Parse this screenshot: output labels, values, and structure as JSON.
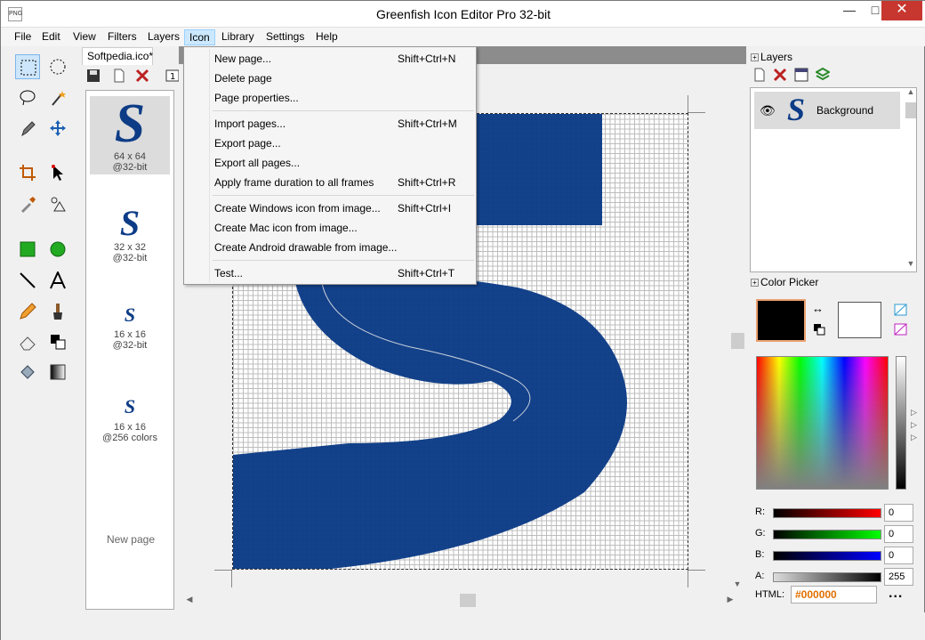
{
  "window": {
    "title": "Greenfish Icon Editor Pro 32-bit",
    "app_icon_text": "PNG",
    "minimize": "—",
    "maximize": "□",
    "close": "✕"
  },
  "menubar": {
    "items": [
      "File",
      "Edit",
      "View",
      "Filters",
      "Layers",
      "Icon",
      "Library",
      "Settings",
      "Help"
    ],
    "active": "Icon"
  },
  "document": {
    "tab_label": "Softpedia.ico*"
  },
  "pages": {
    "items": [
      {
        "size": "64 x 64",
        "depth": "@32-bit"
      },
      {
        "size": "32 x 32",
        "depth": "@32-bit"
      },
      {
        "size": "16 x 16",
        "depth": "@32-bit"
      },
      {
        "size": "16 x 16",
        "depth": "@256 colors"
      }
    ],
    "new_page": "New page",
    "thumb_glyph": "S"
  },
  "icon_menu": {
    "items": [
      {
        "label": "New page...",
        "shortcut": "Shift+Ctrl+N"
      },
      {
        "label": "Delete page",
        "shortcut": ""
      },
      {
        "label": "Page properties...",
        "shortcut": ""
      },
      {
        "label": "Import pages...",
        "shortcut": "Shift+Ctrl+M"
      },
      {
        "label": "Export page...",
        "shortcut": ""
      },
      {
        "label": "Export all pages...",
        "shortcut": ""
      },
      {
        "label": "Apply frame duration to all frames",
        "shortcut": "Shift+Ctrl+R"
      },
      {
        "label": "Create Windows icon from image...",
        "shortcut": "Shift+Ctrl+I"
      },
      {
        "label": "Create Mac icon from image...",
        "shortcut": ""
      },
      {
        "label": "Create Android drawable from image...",
        "shortcut": ""
      },
      {
        "label": "Test...",
        "shortcut": "Shift+Ctrl+T"
      }
    ]
  },
  "layers": {
    "header": "Layers",
    "items": [
      {
        "name": "Background"
      }
    ],
    "thumb_glyph": "S"
  },
  "color_picker": {
    "header": "Color Picker",
    "primary_color": "#000000",
    "secondary_color": "#ffffff",
    "channels": [
      {
        "label": "R:",
        "value": "0"
      },
      {
        "label": "G:",
        "value": "0"
      },
      {
        "label": "B:",
        "value": "0"
      },
      {
        "label": "A:",
        "value": "255"
      }
    ],
    "html_label": "HTML:",
    "html_value": "#000000",
    "more": "..."
  },
  "colors": {
    "accent_blue": "#0d3c86",
    "menu_highlight": "#cce8ff",
    "close_red": "#c7372f",
    "hex_orange": "#e07000"
  },
  "tools": [
    "marquee-rect",
    "marquee-ellipse",
    "lasso",
    "magic-wand",
    "pen-selection",
    "move",
    "crop",
    "pointer",
    "eyedropper",
    "color-replace",
    "rectangle",
    "ellipse",
    "line",
    "text",
    "pencil",
    "brush",
    "eraser",
    "color-swap",
    "fill",
    "gradient"
  ]
}
